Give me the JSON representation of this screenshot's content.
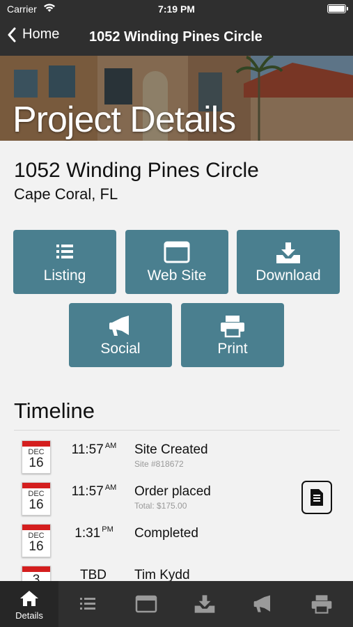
{
  "status_bar": {
    "carrier": "Carrier",
    "time": "7:19 PM"
  },
  "nav": {
    "back_label": "Home",
    "title": "1052 Winding Pines Circle"
  },
  "hero": {
    "title": "Project Details"
  },
  "property": {
    "address": "1052 Winding Pines Circle",
    "city": "Cape Coral, FL"
  },
  "actions": [
    {
      "label": "Listing",
      "icon": "list-icon"
    },
    {
      "label": "Web Site",
      "icon": "browser-window-icon"
    },
    {
      "label": "Download",
      "icon": "download-tray-icon"
    },
    {
      "label": "Social",
      "icon": "megaphone-icon"
    },
    {
      "label": "Print",
      "icon": "printer-icon"
    }
  ],
  "timeline": {
    "heading": "Timeline",
    "items": [
      {
        "month": "DEC",
        "day": "16",
        "time": "11:57",
        "ampm": "AM",
        "title": "Site Created",
        "subtitle": "Site #818672"
      },
      {
        "month": "DEC",
        "day": "16",
        "time": "11:57",
        "ampm": "AM",
        "title": "Order placed",
        "subtitle": "Total: $175.00",
        "action_icon": "document-icon"
      },
      {
        "month": "DEC",
        "day": "16",
        "time": "1:31",
        "ampm": "PM",
        "title": "Completed",
        "subtitle": ""
      },
      {
        "month": "",
        "day": "3",
        "time": "TBD",
        "ampm": "",
        "title": "Tim Kydd",
        "subtitle": ""
      }
    ]
  },
  "tab_bar": {
    "tabs": [
      {
        "label": "Details",
        "icon": "home-icon",
        "active": true
      },
      {
        "label": "",
        "icon": "list-icon"
      },
      {
        "label": "",
        "icon": "browser-window-icon"
      },
      {
        "label": "",
        "icon": "download-tray-icon"
      },
      {
        "label": "",
        "icon": "megaphone-icon"
      },
      {
        "label": "",
        "icon": "printer-icon"
      }
    ]
  },
  "colors": {
    "bar": "#2f2f2f",
    "button": "#4a7f8f",
    "calendar_red": "#d41e1e",
    "background": "#f2f2f2"
  }
}
